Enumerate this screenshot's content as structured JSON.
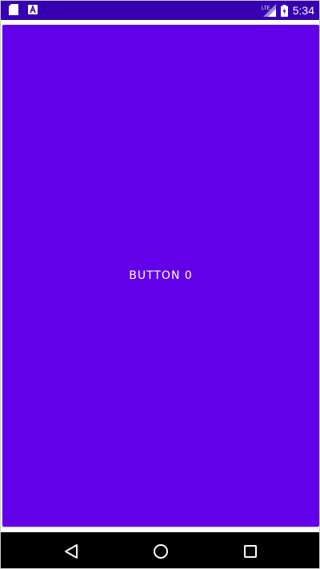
{
  "status_bar": {
    "time": "5:34",
    "network_label": "LTE",
    "icons": [
      "sd-card-icon",
      "a-notification-icon",
      "lte-signal-icon",
      "battery-charging-icon"
    ],
    "background_color": "#3700b3"
  },
  "main": {
    "button_label": "BUTTON 0",
    "button_color": "#6200ea"
  },
  "nav_bar": {
    "buttons": [
      "back-icon",
      "home-icon",
      "recents-icon"
    ],
    "background_color": "#000000"
  }
}
